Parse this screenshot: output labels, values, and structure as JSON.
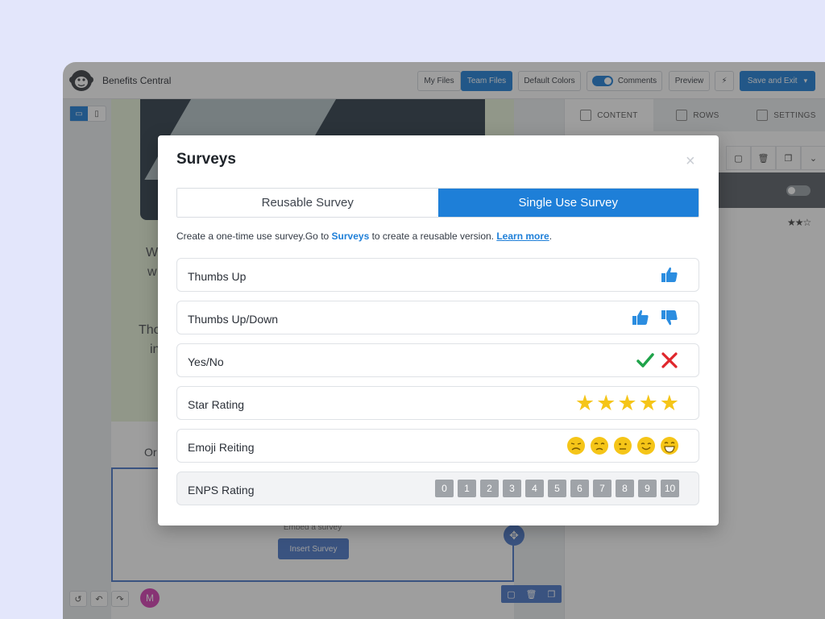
{
  "app": {
    "title": "Benefits Central",
    "topbar": {
      "my_files": "My Files",
      "team_files": "Team Files",
      "default_colors": "Default Colors",
      "comments": "Comments",
      "preview": "Preview",
      "save_exit": "Save and Exit"
    },
    "side_tabs": [
      "CONTENT",
      "ROWS",
      "SETTINGS"
    ],
    "canvas": {
      "fragments": [
        "W",
        "w",
        "Tho",
        "in",
        "Or"
      ],
      "embed_label": "Embed a survey",
      "insert_button": "Insert Survey"
    },
    "avatar_initial": "M"
  },
  "modal": {
    "title": "Surveys",
    "close_glyph": "×",
    "tabs": [
      {
        "label": "Reusable Survey",
        "active": false
      },
      {
        "label": "Single Use Survey",
        "active": true
      }
    ],
    "description": {
      "text": "Create a one-time use survey.Go to ",
      "link_surveys": "Surveys",
      "middle": " to create a reusable version. ",
      "link_learn": "Learn more",
      "end": "."
    },
    "options": [
      {
        "label": "Thumbs Up",
        "icons": [
          "thumbs-up-icon"
        ]
      },
      {
        "label": "Thumbs Up/Down",
        "icons": [
          "thumbs-up-icon",
          "thumbs-down-icon"
        ]
      },
      {
        "label": "Yes/No",
        "icons": [
          "check-icon",
          "cross-icon"
        ]
      },
      {
        "label": "Star Rating",
        "icons": [
          "star-icon",
          "star-icon",
          "star-icon",
          "star-icon",
          "star-icon"
        ]
      },
      {
        "label": "Emoji Reiting",
        "icons": [
          "emoji-icon",
          "emoji-icon",
          "emoji-icon",
          "emoji-icon",
          "emoji-icon"
        ]
      },
      {
        "label": "ENPS Rating",
        "numbers": [
          "0",
          "1",
          "2",
          "3",
          "4",
          "5",
          "6",
          "7",
          "8",
          "9",
          "10"
        ]
      }
    ]
  },
  "colors": {
    "accent": "#1e7fd8",
    "star": "#f5c518",
    "check": "#1fa34a",
    "cross": "#e0262b",
    "thumb": "#2b8de0"
  }
}
